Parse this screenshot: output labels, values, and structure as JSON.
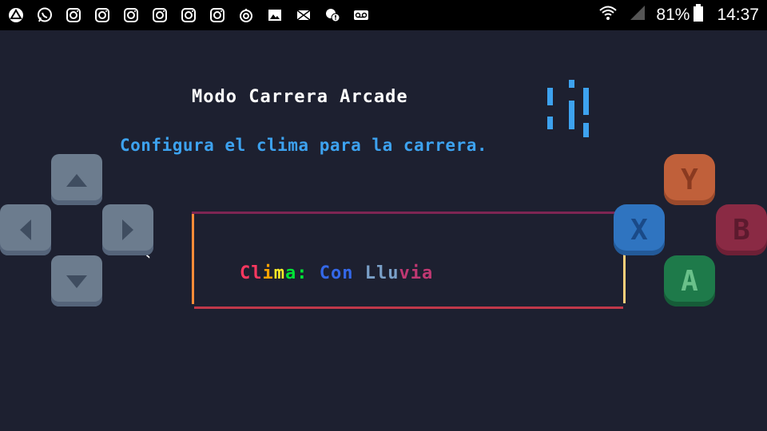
{
  "status_bar": {
    "icons": [
      "drive-icon",
      "whatsapp-icon",
      "instagram-icon",
      "instagram-icon",
      "instagram-icon",
      "instagram-icon",
      "instagram-icon",
      "instagram-icon",
      "sync-icon",
      "gallery-icon",
      "mail-icon",
      "chat-alert-icon",
      "voicemail-icon"
    ],
    "battery_percent": "81%",
    "time": "14:37"
  },
  "game": {
    "title": "Modo Carrera Arcade",
    "subtitle": "Configura el clima para la carrera.",
    "clima_label": "Clima:",
    "clima_value": "Con Lluvia"
  },
  "controls": {
    "dpad": [
      "up-arrow-icon",
      "left-arrow-icon",
      "right-arrow-icon",
      "down-arrow-icon"
    ],
    "buttons": {
      "y": "Y",
      "x": "X",
      "b": "B",
      "a": "A"
    }
  },
  "colors": {
    "background": "#1d2030",
    "subtitle": "#3da2ef",
    "btn_y": "#c0603a",
    "btn_x": "#2f74c0",
    "btn_b": "#8a2a44",
    "btn_a": "#1e7a4a"
  }
}
